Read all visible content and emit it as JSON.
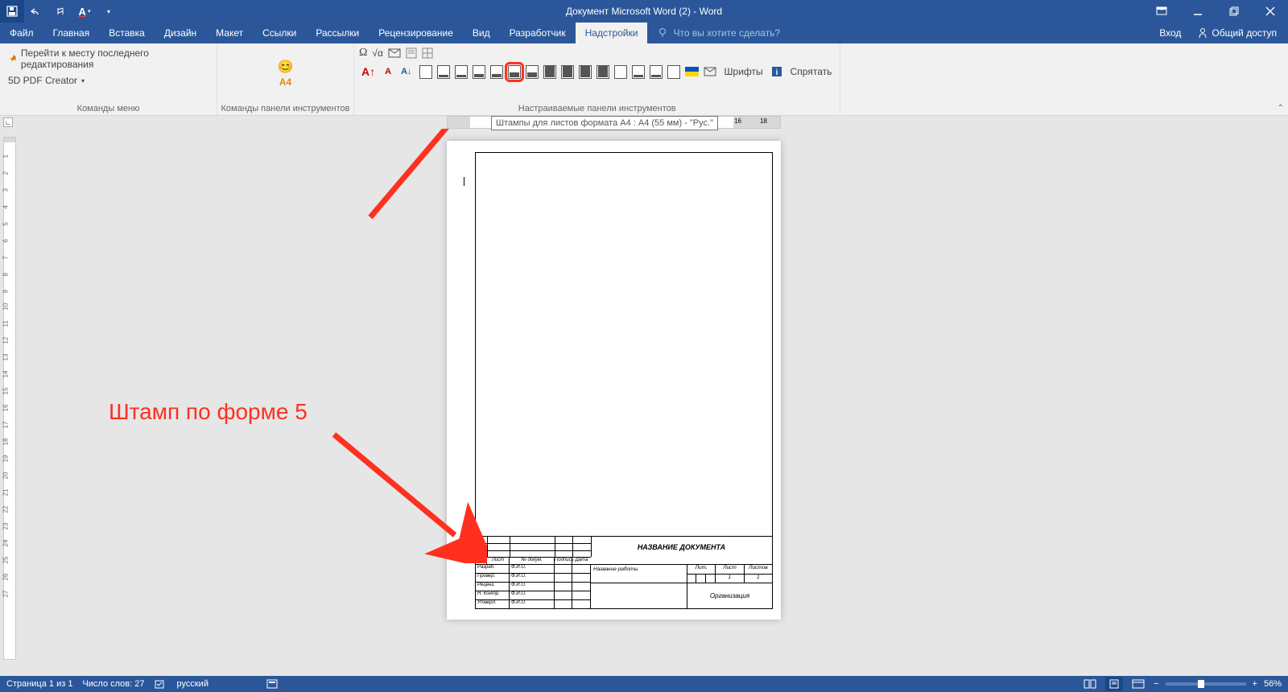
{
  "title": "Документ Microsoft Word (2) - Word",
  "tabs": {
    "file": "Файл",
    "home": "Главная",
    "insert": "Вставка",
    "design": "Дизайн",
    "layout": "Макет",
    "references": "Ссылки",
    "mailings": "Рассылки",
    "review": "Рецензирование",
    "view": "Вид",
    "developer": "Разработчик",
    "addins": "Надстройки"
  },
  "tell_me": "Что вы хотите сделать?",
  "sign_in": "Вход",
  "share": "Общий доступ",
  "ribbon": {
    "group1_label": "Команды меню",
    "group2_label": "Команды панели инструментов",
    "group3_label": "Настраиваемые панели инструментов",
    "goto_last_edit": "Перейти к месту последнего редактирования",
    "pdf_creator": "5D PDF Creator",
    "fonts": "Шрифты",
    "hide": "Спрятать",
    "a4_label": "А4"
  },
  "tooltip": "Штампы для листов формата А4 : А4 (55 мм) - \"Рус.\"",
  "ruler_marks": [
    "16",
    "18"
  ],
  "annotation": "Штамп по форме 5",
  "title_block": {
    "doc_name": "НАЗВАНИЕ ДОКУМЕНТА",
    "work_name": "Название работы",
    "organization": "Организация",
    "cols": [
      "Изм.",
      "Лист",
      "№ докум.",
      "Подпись",
      "Дата"
    ],
    "rows": [
      "Разраб.",
      "Провер.",
      "Реценз.",
      "Н. Контр.",
      "Утверд."
    ],
    "fio": "Ф.И.О.",
    "lit": "Лит.",
    "list": "Лист",
    "listov": "Листов",
    "list_val": "1",
    "listov_val": "1"
  },
  "status": {
    "page": "Страница 1 из 1",
    "words": "Число слов: 27",
    "lang": "русский",
    "zoom": "56%"
  }
}
